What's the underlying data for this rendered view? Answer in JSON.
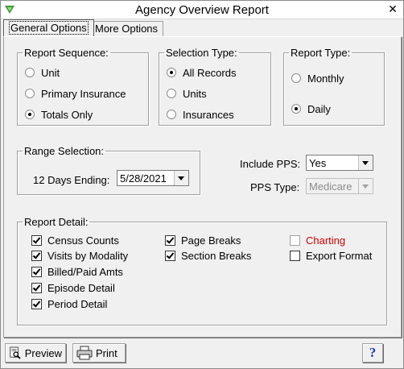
{
  "window": {
    "title": "Agency Overview Report",
    "close_glyph": "✕"
  },
  "tabs": [
    {
      "label": "General Options"
    },
    {
      "label": "More Options"
    }
  ],
  "report_sequence": {
    "legend": "Report Sequence:",
    "options": [
      {
        "label": "Unit",
        "selected": false
      },
      {
        "label": "Primary Insurance",
        "selected": false
      },
      {
        "label": "Totals Only",
        "selected": true
      }
    ]
  },
  "selection_type": {
    "legend": "Selection Type:",
    "options": [
      {
        "label": "All Records",
        "selected": true
      },
      {
        "label": "Units",
        "selected": false
      },
      {
        "label": "Insurances",
        "selected": false
      }
    ]
  },
  "report_type": {
    "legend": "Report Type:",
    "options": [
      {
        "label": "Monthly",
        "selected": false
      },
      {
        "label": "Daily",
        "selected": true
      }
    ]
  },
  "range_selection": {
    "legend": "Range Selection:",
    "days_label": "12 Days Ending:",
    "date_value": "5/28/2021"
  },
  "pps": {
    "include_label": "Include PPS:",
    "include_value": "Yes",
    "type_label": "PPS Type:",
    "type_value": "Medicare"
  },
  "report_detail": {
    "legend": "Report Detail:",
    "items": [
      {
        "label": "Census Counts",
        "checked": true
      },
      {
        "label": "Visits by Modality",
        "checked": true
      },
      {
        "label": "Billed/Paid Amts",
        "checked": true
      },
      {
        "label": "Episode Detail",
        "checked": true
      },
      {
        "label": "Period Detail",
        "checked": true
      },
      {
        "label": "Page Breaks",
        "checked": true
      },
      {
        "label": "Section Breaks",
        "checked": true
      },
      {
        "label": "Charting",
        "checked": false,
        "color": "#cc0000"
      },
      {
        "label": "Export Format",
        "checked": false
      }
    ]
  },
  "buttons": {
    "preview_label": "Preview",
    "print_label": "Print",
    "help_glyph": "?"
  }
}
